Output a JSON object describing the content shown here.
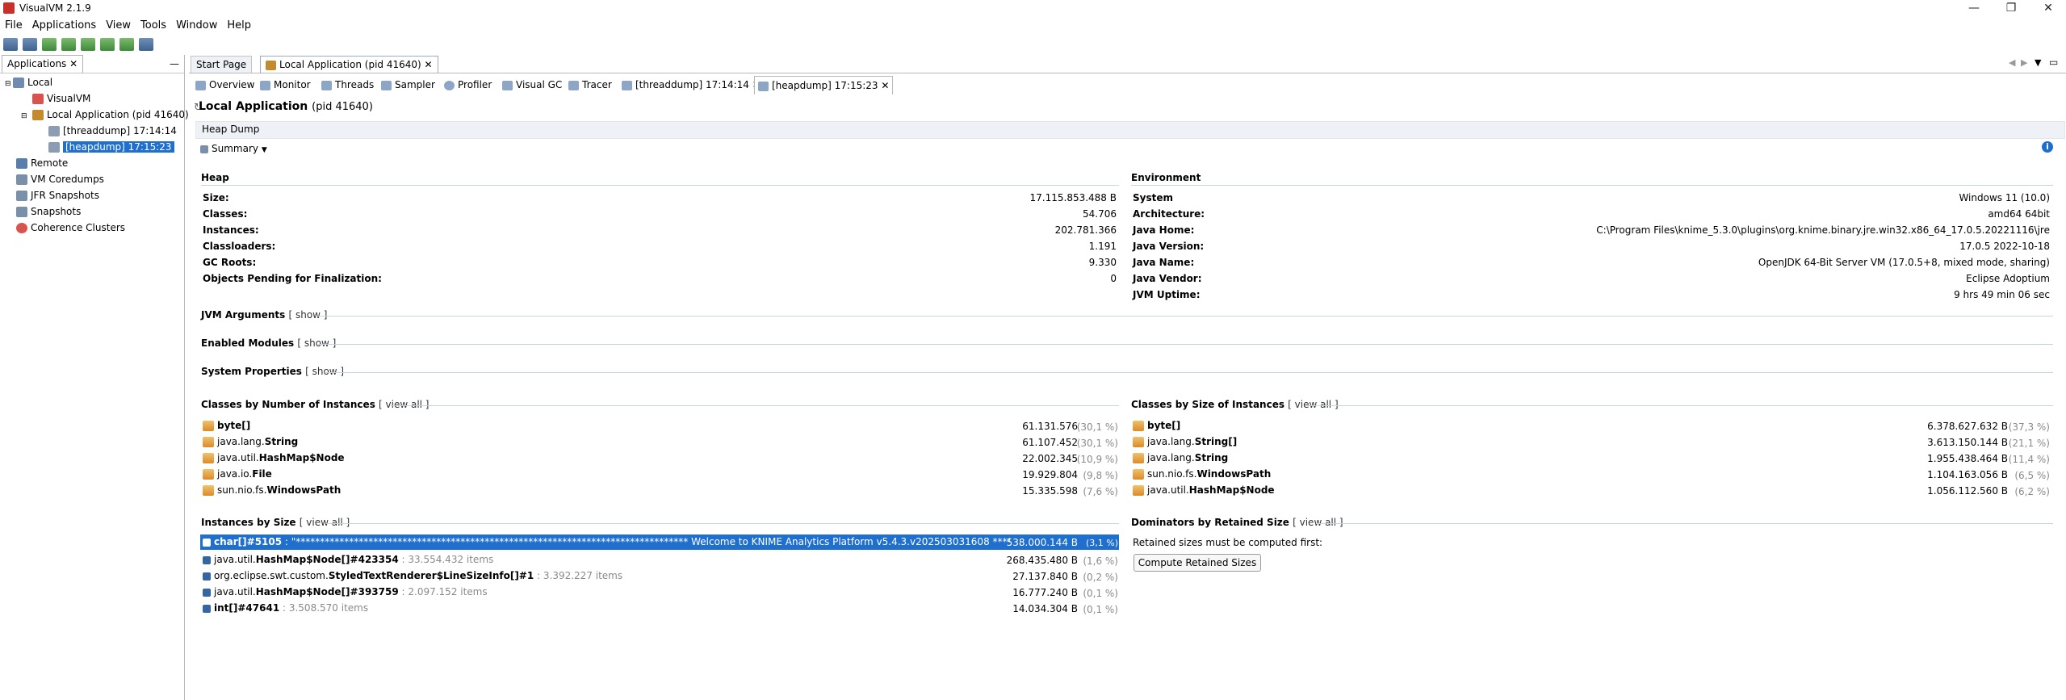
{
  "window": {
    "title": "VisualVM 2.1.9",
    "controls": [
      "—",
      "❐",
      "✕"
    ]
  },
  "menu": [
    "File",
    "Applications",
    "View",
    "Tools",
    "Window",
    "Help"
  ],
  "left_panel": {
    "tab_label": "Applications",
    "tree": [
      {
        "label": "Local",
        "level": 0
      },
      {
        "label": "VisualVM",
        "level": 1
      },
      {
        "label": "Local Application (pid 41640)",
        "level": 1
      },
      {
        "label": "[threaddump] 17:14:14",
        "level": 2
      },
      {
        "label": "[heapdump] 17:15:23",
        "level": 2,
        "selected": true
      },
      {
        "label": "Remote",
        "level": 0
      },
      {
        "label": "VM Coredumps",
        "level": 0
      },
      {
        "label": "JFR Snapshots",
        "level": 0
      },
      {
        "label": "Snapshots",
        "level": 0
      },
      {
        "label": "Coherence Clusters",
        "level": 0
      }
    ]
  },
  "doc_tabs": [
    "Start Page",
    "Local Application (pid 41640)"
  ],
  "sub_tabs": [
    "Overview",
    "Monitor",
    "Threads",
    "Sampler",
    "Profiler",
    "Visual GC",
    "Tracer",
    "[threaddump] 17:14:14",
    "[heapdump] 17:15:23"
  ],
  "header": {
    "title": "Local Application",
    "pid": "(pid 41640)"
  },
  "heap_dump_label": "Heap Dump",
  "summary_label": "Summary",
  "heap": {
    "title": "Heap",
    "rows": [
      {
        "k": "Size:",
        "v": "17.115.853.488 B"
      },
      {
        "k": "Classes:",
        "v": "54.706"
      },
      {
        "k": "Instances:",
        "v": "202.781.366"
      },
      {
        "k": "Classloaders:",
        "v": "1.191"
      },
      {
        "k": "GC Roots:",
        "v": "9.330"
      },
      {
        "k": "Objects Pending for Finalization:",
        "v": "0"
      }
    ]
  },
  "environment": {
    "title": "Environment",
    "rows": [
      {
        "k": "System",
        "v": "Windows 11 (10.0)"
      },
      {
        "k": "Architecture:",
        "v": "amd64 64bit"
      },
      {
        "k": "Java Home:",
        "v": "C:\\Program Files\\knime_5.3.0\\plugins\\org.knime.binary.jre.win32.x86_64_17.0.5.20221116\\jre"
      },
      {
        "k": "Java Version:",
        "v": "17.0.5 2022-10-18"
      },
      {
        "k": "Java Name:",
        "v": "OpenJDK 64-Bit Server VM (17.0.5+8, mixed mode, sharing)"
      },
      {
        "k": "Java Vendor:",
        "v": "Eclipse Adoptium"
      },
      {
        "k": "JVM Uptime:",
        "v": "9 hrs 49 min 06 sec"
      }
    ]
  },
  "collapsed": [
    {
      "title": "JVM Arguments",
      "link": "[ show ]"
    },
    {
      "title": "Enabled Modules",
      "link": "[ show ]"
    },
    {
      "title": "System Properties",
      "link": "[ show ]"
    }
  ],
  "classes_by_instances": {
    "title": "Classes by Number of Instances",
    "link": "[ view all ]",
    "rows": [
      {
        "pkg": "",
        "cls": "byte[]",
        "val": "61.131.576",
        "pct": "(30,1 %)"
      },
      {
        "pkg": "java.lang.",
        "cls": "String",
        "val": "61.107.452",
        "pct": "(30,1 %)"
      },
      {
        "pkg": "java.util.",
        "cls": "HashMap$Node",
        "val": "22.002.345",
        "pct": "(10,9 %)"
      },
      {
        "pkg": "java.io.",
        "cls": "File",
        "val": "19.929.804",
        "pct": "(9,8 %)"
      },
      {
        "pkg": "sun.nio.fs.",
        "cls": "WindowsPath",
        "val": "15.335.598",
        "pct": "(7,6 %)"
      }
    ]
  },
  "classes_by_size": {
    "title": "Classes by Size of Instances",
    "link": "[ view all ]",
    "rows": [
      {
        "pkg": "",
        "cls": "byte[]",
        "val": "6.378.627.632 B",
        "pct": "(37,3 %)"
      },
      {
        "pkg": "java.lang.",
        "cls": "String[]",
        "val": "3.613.150.144 B",
        "pct": "(21,1 %)"
      },
      {
        "pkg": "java.lang.",
        "cls": "String",
        "val": "1.955.438.464 B",
        "pct": "(11,4 %)"
      },
      {
        "pkg": "sun.nio.fs.",
        "cls": "WindowsPath",
        "val": "1.104.163.056 B",
        "pct": "(6,5 %)"
      },
      {
        "pkg": "java.util.",
        "cls": "HashMap$Node",
        "val": "1.056.112.560 B",
        "pct": "(6,2 %)"
      }
    ]
  },
  "instances_by_size": {
    "title": "Instances by Size",
    "link": "[ view all ]",
    "rows": [
      {
        "pkg": "",
        "cls": "char[]#5105",
        "extra": " : \"*********************************************************************************          Welcome to KNIME Analytics Platform v5.4.3.v202503031608          *****...",
        "val": "538.000.144 B",
        "pct": "(3,1 %)",
        "selected": true
      },
      {
        "pkg": "java.util.",
        "cls": "HashMap$Node[]#423354",
        "extra": " : 33.554.432 items",
        "val": "268.435.480 B",
        "pct": "(1,6 %)"
      },
      {
        "pkg": "org.eclipse.swt.custom.",
        "cls": "StyledTextRenderer$LineSizeInfo[]#1",
        "extra": " : 3.392.227 items",
        "val": "27.137.840 B",
        "pct": "(0,2 %)"
      },
      {
        "pkg": "java.util.",
        "cls": "HashMap$Node[]#393759",
        "extra": " : 2.097.152 items",
        "val": "16.777.240 B",
        "pct": "(0,1 %)"
      },
      {
        "pkg": "",
        "cls": "int[]#47641",
        "extra": " : 3.508.570 items",
        "val": "14.034.304 B",
        "pct": "(0,1 %)"
      }
    ]
  },
  "dominators": {
    "title": "Dominators by Retained Size",
    "link": "[ view all ]",
    "note": "Retained sizes must be computed first:",
    "button": "Compute Retained Sizes"
  }
}
